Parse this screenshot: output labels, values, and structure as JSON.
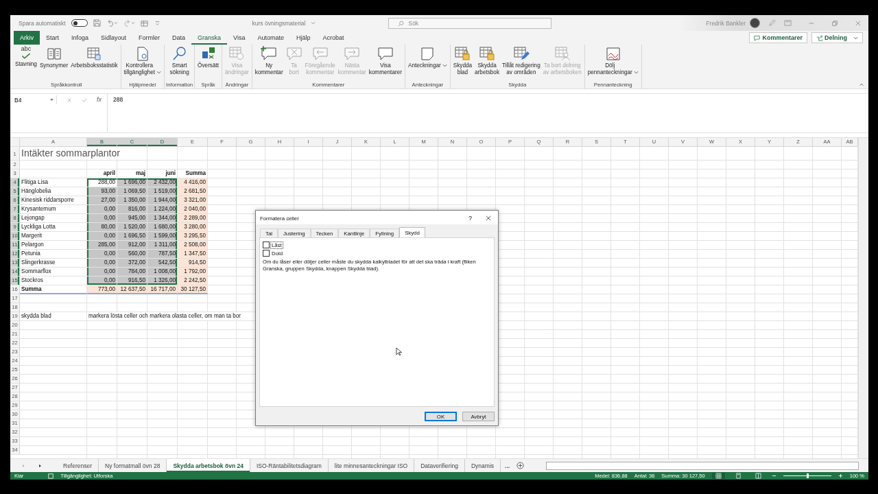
{
  "title_bar": {
    "autosave": {
      "label": "Spara automatiskt",
      "on": false
    },
    "document": "kurs övningsmaterial",
    "search": {
      "placeholder": "Sök"
    },
    "user": "Fredrik Bankler"
  },
  "menu_tabs": [
    {
      "label": "Arkiv",
      "kind": "file",
      "selected": false
    },
    {
      "label": "Start",
      "kind": "tab",
      "selected": false
    },
    {
      "label": "Infoga",
      "kind": "tab",
      "selected": false
    },
    {
      "label": "Sidlayout",
      "kind": "tab",
      "selected": false
    },
    {
      "label": "Formler",
      "kind": "tab",
      "selected": false
    },
    {
      "label": "Data",
      "kind": "tab",
      "selected": false
    },
    {
      "label": "Granska",
      "kind": "tab",
      "selected": true
    },
    {
      "label": "Visa",
      "kind": "tab",
      "selected": false
    },
    {
      "label": "Automate",
      "kind": "tab",
      "selected": false
    },
    {
      "label": "Hjälp",
      "kind": "tab",
      "selected": false
    },
    {
      "label": "Acrobat",
      "kind": "tab",
      "selected": false
    }
  ],
  "header_buttons": [
    {
      "label": "Kommentarer",
      "kind": "comments"
    },
    {
      "label": "Delning",
      "kind": "share"
    }
  ],
  "ribbon": [
    {
      "name": "Språkkontroll",
      "buttons": [
        {
          "label": "Stavning",
          "icon_text": "abc",
          "disabled": false,
          "menu": false
        },
        {
          "label": "Synonymer",
          "disabled": false,
          "menu": false
        },
        {
          "label": "Arbetsboksstatistik",
          "disabled": false,
          "menu": false
        }
      ]
    },
    {
      "name": "Hjälpmedel",
      "buttons": [
        {
          "label": "Kontrollera\ntillgänglighet",
          "disabled": false,
          "menu": true
        }
      ]
    },
    {
      "name": "Information",
      "buttons": [
        {
          "label": "Smart\nsökning",
          "disabled": false,
          "menu": false
        }
      ]
    },
    {
      "name": "Språk",
      "buttons": [
        {
          "label": "Översätt",
          "disabled": false,
          "menu": false
        }
      ]
    },
    {
      "name": "Ändringar",
      "buttons": [
        {
          "label": "Visa\nändringar",
          "disabled": true,
          "menu": false
        }
      ]
    },
    {
      "name": "Kommentarer",
      "buttons": [
        {
          "label": "Ny\nkommentar",
          "disabled": false,
          "menu": false
        },
        {
          "label": "Ta\nbort",
          "disabled": true,
          "menu": false
        },
        {
          "label": "Föregående\nkommentar",
          "disabled": true,
          "menu": false
        },
        {
          "label": "Nästa\nkommentar",
          "disabled": true,
          "menu": false
        },
        {
          "label": "Visa\nkommentarer",
          "disabled": false,
          "menu": false
        }
      ]
    },
    {
      "name": "Anteckningar",
      "buttons": [
        {
          "label": "Anteckningar",
          "disabled": false,
          "menu": true
        }
      ]
    },
    {
      "name": "Skydda",
      "buttons": [
        {
          "label": "Skydda\nblad",
          "disabled": false,
          "menu": false
        },
        {
          "label": "Skydda\narbetsbok",
          "disabled": false,
          "menu": false
        },
        {
          "label": "Tillåt redigering\nav områden",
          "disabled": false,
          "menu": false
        },
        {
          "label": "Ta bort delning\nav arbetsboken",
          "disabled": true,
          "menu": false
        }
      ]
    },
    {
      "name": "Pennanteckning",
      "buttons": [
        {
          "label": "Dölj\npennanteckningar",
          "disabled": false,
          "menu": true
        }
      ]
    }
  ],
  "formula_bar": {
    "name_box": "B4",
    "fx": "fx",
    "value": "288"
  },
  "grid": {
    "columns": [
      {
        "label": "A",
        "selected": false
      },
      {
        "label": "B",
        "selected": true
      },
      {
        "label": "C",
        "selected": true
      },
      {
        "label": "D",
        "selected": true
      },
      {
        "label": "E",
        "selected": false
      },
      {
        "label": "F",
        "selected": false
      },
      {
        "label": "G",
        "selected": false
      },
      {
        "label": "H",
        "selected": false
      },
      {
        "label": "I",
        "selected": false
      },
      {
        "label": "J",
        "selected": false
      },
      {
        "label": "K",
        "selected": false
      },
      {
        "label": "L",
        "selected": false
      },
      {
        "label": "M",
        "selected": false
      },
      {
        "label": "N",
        "selected": false
      },
      {
        "label": "O",
        "selected": false
      },
      {
        "label": "P",
        "selected": false
      },
      {
        "label": "Q",
        "selected": false
      },
      {
        "label": "R",
        "selected": false
      },
      {
        "label": "S",
        "selected": false
      },
      {
        "label": "T",
        "selected": false
      },
      {
        "label": "U",
        "selected": false
      },
      {
        "label": "V",
        "selected": false
      },
      {
        "label": "W",
        "selected": false
      },
      {
        "label": "X",
        "selected": false
      },
      {
        "label": "Y",
        "selected": false
      },
      {
        "label": "Z",
        "selected": false
      },
      {
        "label": "AA",
        "selected": false
      },
      {
        "label": "AB",
        "selected": false
      }
    ],
    "rows": [
      {
        "number": "1",
        "kind": "title",
        "selected": false,
        "a": "Intäkter sommarplantor"
      },
      {
        "number": "2",
        "kind": "empty",
        "selected": false
      },
      {
        "number": "3",
        "kind": "header",
        "selected": false,
        "b": "april",
        "c": "maj",
        "d": "juni",
        "e": "Summa"
      },
      {
        "number": "4",
        "kind": "data",
        "selected": true,
        "active": true,
        "a": "Flitiga Lisa",
        "b": "288,00",
        "c": "1 696,00",
        "d": "2 432,00",
        "e": "4 416,00"
      },
      {
        "number": "5",
        "kind": "data",
        "selected": true,
        "active": false,
        "a": "Hänglobelia",
        "b": "93,00",
        "c": "1 069,50",
        "d": "1 519,00",
        "e": "2 681,50"
      },
      {
        "number": "6",
        "kind": "data",
        "selected": true,
        "active": false,
        "a": "Kinesisk riddarsporre",
        "b": "27,00",
        "c": "1 350,00",
        "d": "1 944,00",
        "e": "3 321,00"
      },
      {
        "number": "7",
        "kind": "data",
        "selected": true,
        "active": false,
        "a": "Krysantemum",
        "b": "0,00",
        "c": "816,00",
        "d": "1 224,00",
        "e": "2 040,00"
      },
      {
        "number": "8",
        "kind": "data",
        "selected": true,
        "active": false,
        "a": "Lejongap",
        "b": "0,00",
        "c": "945,00",
        "d": "1 344,00",
        "e": "2 289,00"
      },
      {
        "number": "9",
        "kind": "data",
        "selected": true,
        "active": false,
        "a": "Lyckliga Lotta",
        "b": "80,00",
        "c": "1 520,00",
        "d": "1 680,00",
        "e": "3 280,00"
      },
      {
        "number": "10",
        "kind": "data",
        "selected": true,
        "active": false,
        "a": "Margerit",
        "b": "0,00",
        "c": "1 696,50",
        "d": "1 599,00",
        "e": "3 295,50"
      },
      {
        "number": "11",
        "kind": "data",
        "selected": true,
        "active": false,
        "a": "Pelargon",
        "b": "285,00",
        "c": "912,00",
        "d": "1 311,00",
        "e": "2 508,00"
      },
      {
        "number": "12",
        "kind": "data",
        "selected": true,
        "active": false,
        "a": "Petunia",
        "b": "0,00",
        "c": "560,00",
        "d": "787,50",
        "e": "1 347,50"
      },
      {
        "number": "13",
        "kind": "data",
        "selected": true,
        "active": false,
        "a": "Slingerkrasse",
        "b": "0,00",
        "c": "372,00",
        "d": "542,50",
        "e": "914,50"
      },
      {
        "number": "14",
        "kind": "data",
        "selected": true,
        "active": false,
        "a": "Sommarflox",
        "b": "0,00",
        "c": "784,00",
        "d": "1 008,00",
        "e": "1 792,00"
      },
      {
        "number": "15",
        "kind": "data",
        "selected": true,
        "active": false,
        "a": "Stockros",
        "b": "0,00",
        "c": "916,50",
        "d": "1 326,00",
        "e": "2 242,50"
      },
      {
        "number": "16",
        "kind": "total",
        "selected": false,
        "a": "Summa",
        "b": "773,00",
        "c": "12 637,50",
        "d": "16 717,00",
        "e": "30 127,50"
      },
      {
        "number": "17",
        "kind": "empty",
        "selected": false
      },
      {
        "number": "18",
        "kind": "empty",
        "selected": false
      },
      {
        "number": "19",
        "kind": "note",
        "selected": false,
        "a": "skydda blad",
        "b": "markera lösta celler och markera olasta celler, om man ta bor"
      },
      {
        "number": "20",
        "kind": "empty",
        "selected": false
      },
      {
        "number": "21",
        "kind": "empty",
        "selected": false
      },
      {
        "number": "22",
        "kind": "empty",
        "selected": false
      },
      {
        "number": "23",
        "kind": "empty",
        "selected": false
      },
      {
        "number": "24",
        "kind": "empty",
        "selected": false
      },
      {
        "number": "25",
        "kind": "empty",
        "selected": false
      },
      {
        "number": "26",
        "kind": "empty",
        "selected": false
      },
      {
        "number": "27",
        "kind": "empty",
        "selected": false
      },
      {
        "number": "28",
        "kind": "empty",
        "selected": false
      },
      {
        "number": "29",
        "kind": "empty",
        "selected": false
      },
      {
        "number": "30",
        "kind": "empty",
        "selected": false
      },
      {
        "number": "31",
        "kind": "empty",
        "selected": false
      },
      {
        "number": "32",
        "kind": "empty",
        "selected": false
      },
      {
        "number": "33",
        "kind": "empty",
        "selected": false
      },
      {
        "number": "34",
        "kind": "empty",
        "selected": false
      }
    ]
  },
  "dialog": {
    "title": "Formatera celler",
    "help": "?",
    "tabs": [
      {
        "label": "Tal",
        "selected": false
      },
      {
        "label": "Justering",
        "selected": false
      },
      {
        "label": "Tecken",
        "selected": false
      },
      {
        "label": "Kantlinje",
        "selected": false
      },
      {
        "label": "Fyllning",
        "selected": false
      },
      {
        "label": "Skydd",
        "selected": true
      }
    ],
    "checkboxes": [
      {
        "label": "Låst",
        "checked": false,
        "focused": true
      },
      {
        "label": "Dold",
        "checked": false,
        "focused": false
      }
    ],
    "text": "Om du låser eller döljer celler måste du skydda kalkylbladet för att det ska träda i kraft (fliken Granska, gruppen Skydda, knappen Skydda blad).",
    "buttons": [
      {
        "label": "OK",
        "default": true
      },
      {
        "label": "Avbryt",
        "default": false
      }
    ]
  },
  "sheet_tabs": {
    "tabs": [
      {
        "label": "Referenser",
        "selected": false
      },
      {
        "label": "Ny formatmall övn 28",
        "selected": false
      },
      {
        "label": "Skydda arbetsbok övn 24",
        "selected": true
      },
      {
        "label": "ISO-Räntabilitetsdiagram",
        "selected": false
      },
      {
        "label": "lite minnesanteckningar ISO",
        "selected": false
      },
      {
        "label": "Dataverifiering",
        "selected": false
      },
      {
        "label": "Dynamis",
        "selected": false
      }
    ],
    "more": "..."
  },
  "status_bar": {
    "ready": "Klar",
    "accessibility": "Tillgänglighet: Utforska",
    "average": "Medel: 836,88",
    "count": "Antal: 36",
    "sum": "Summa: 30 127,50",
    "views": [
      {
        "kind": "normal",
        "selected": true
      },
      {
        "kind": "layout",
        "selected": false
      },
      {
        "kind": "break",
        "selected": false
      }
    ],
    "zoom": {
      "level": 0.5,
      "label": "100 %"
    }
  }
}
